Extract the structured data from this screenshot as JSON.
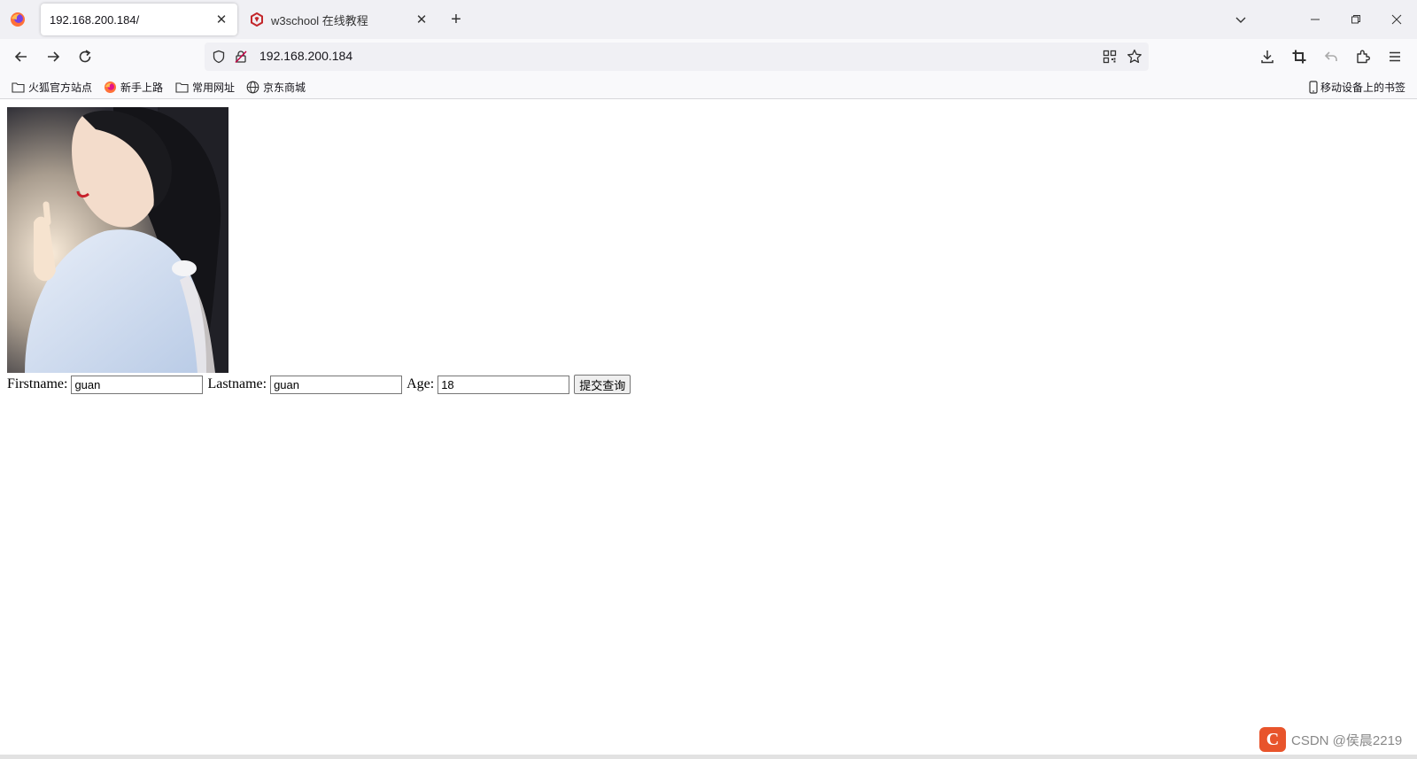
{
  "browser": {
    "tabs": [
      {
        "title": "192.168.200.184/",
        "active": true
      },
      {
        "title": "w3school 在线教程",
        "active": false
      }
    ],
    "url": "192.168.200.184",
    "bookmarks": [
      {
        "label": "火狐官方站点",
        "icon": "folder-icon"
      },
      {
        "label": "新手上路",
        "icon": "firefox-icon"
      },
      {
        "label": "常用网址",
        "icon": "folder-icon"
      },
      {
        "label": "京东商城",
        "icon": "globe-icon"
      }
    ],
    "mobile_bookmarks_label": "移动设备上的书签"
  },
  "page": {
    "image_alt": "photo",
    "form": {
      "firstname_label": "Firstname:",
      "firstname_value": "guan",
      "lastname_label": "Lastname:",
      "lastname_value": "guan",
      "age_label": "Age:",
      "age_value": "18",
      "submit_label": "提交查询"
    }
  },
  "overlay": {
    "watermark_text": "CSDN @侯晨2219"
  },
  "colors": {
    "tabstrip_bg": "#f0f0f4",
    "toolbar_bg": "#f9f9fb",
    "csdn_accent": "#e8542b"
  }
}
